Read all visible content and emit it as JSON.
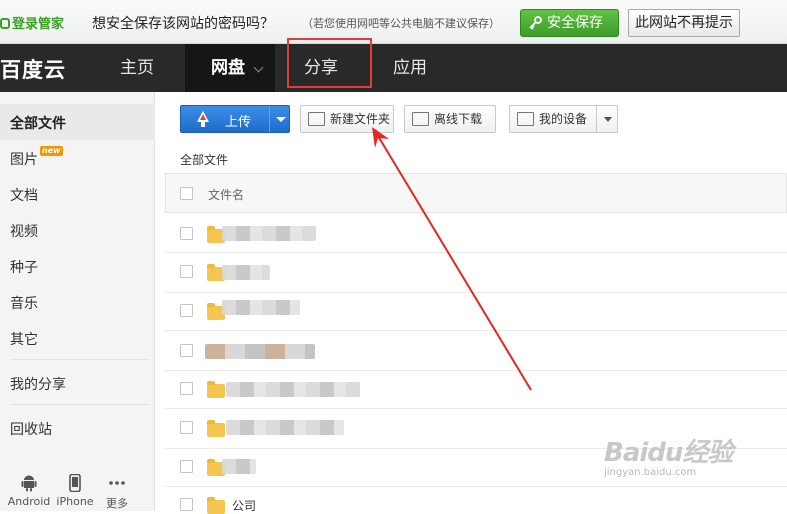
{
  "password_bar": {
    "brand": "登录管家",
    "question": "想安全保存该网站的密码吗？",
    "note": "（若您使用网吧等公共电脑不建议保存）",
    "save_label": "安全保存",
    "never_label": "此网站不再提示"
  },
  "nav": {
    "logo": "百度云",
    "items": [
      {
        "label": "主页"
      },
      {
        "label": "网盘"
      },
      {
        "label": "分享"
      },
      {
        "label": "应用"
      }
    ],
    "active": "网盘",
    "highlighted": "分享"
  },
  "sidebar": {
    "items": [
      {
        "label": "全部文件"
      },
      {
        "label": "图片",
        "badge": "new"
      },
      {
        "label": "文档"
      },
      {
        "label": "视频"
      },
      {
        "label": "种子"
      },
      {
        "label": "音乐"
      },
      {
        "label": "其它"
      },
      {
        "label": "我的分享"
      },
      {
        "label": "回收站"
      }
    ],
    "devices": [
      {
        "label": "Android",
        "icon": "android-icon"
      },
      {
        "label": "iPhone",
        "icon": "iphone-icon"
      },
      {
        "label": "更多",
        "icon": "more-icon"
      }
    ]
  },
  "toolbar": {
    "upload_label": "上传",
    "new_folder_label": "新建文件夹",
    "offline_label": "离线下载",
    "device_label": "我的设备"
  },
  "breadcrumb": "全部文件",
  "table": {
    "header_name": "文件名",
    "rows": [
      {
        "name": ""
      },
      {
        "name": ""
      },
      {
        "name": ""
      },
      {
        "name": ""
      },
      {
        "name": ""
      },
      {
        "name": ""
      },
      {
        "name": ""
      },
      {
        "name": "公司"
      }
    ]
  },
  "watermark": {
    "brand": "Baidu经验",
    "url": "jingyan.baidu.com"
  },
  "colors": {
    "accent_blue": "#1f6ccc",
    "save_green": "#3c9c26",
    "nav_dark": "#292929",
    "highlight_red": "#e53a3a",
    "folder_yellow": "#f5c54f"
  }
}
